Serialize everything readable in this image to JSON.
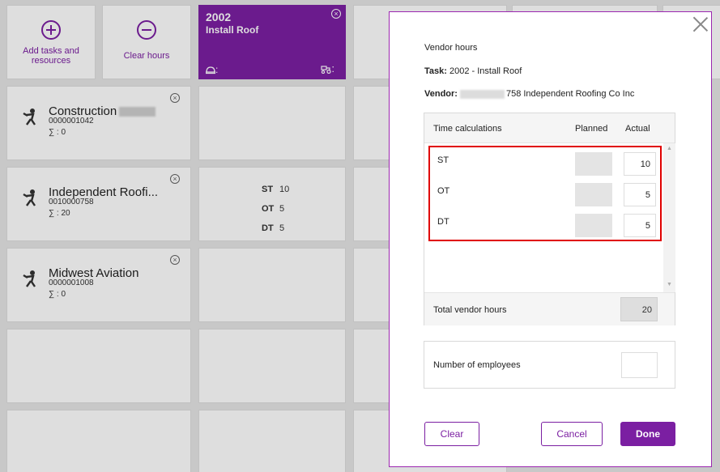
{
  "colors": {
    "accent": "#7b1fa2",
    "highlight": "#e00000"
  },
  "toolbar": {
    "add_label": "Add tasks and resources",
    "clear_label": "Clear hours"
  },
  "task_card": {
    "number": "2002",
    "name": "Install Roof",
    "labor_icon": "hard-hat-icon",
    "labor_value": ":",
    "equipment_icon": "tractor-icon",
    "equipment_value": ":"
  },
  "resources": [
    {
      "name": "Construction",
      "code": "0000001042",
      "sum": "∑ : 0"
    },
    {
      "name": "Independent Roofi...",
      "code": "0010000758",
      "sum": "∑ : 20"
    },
    {
      "name": "Midwest Aviation",
      "code": "0000001008",
      "sum": "∑ : 0"
    }
  ],
  "hours_cell": [
    {
      "label": "ST",
      "value": "10"
    },
    {
      "label": "OT",
      "value": "5"
    },
    {
      "label": "DT",
      "value": "5"
    }
  ],
  "modal": {
    "title": "Vendor hours",
    "task_label": "Task:",
    "task_value": "2002 - Install Roof",
    "vendor_label": "Vendor:",
    "vendor_value": "758 Independent Roofing Co Inc",
    "table": {
      "col_time": "Time calculations",
      "col_planned": "Planned",
      "col_actual": "Actual",
      "rows": [
        {
          "label": "ST",
          "planned": "",
          "actual": "10"
        },
        {
          "label": "OT",
          "planned": "",
          "actual": "5"
        },
        {
          "label": "DT",
          "planned": "",
          "actual": "5"
        }
      ],
      "total_label": "Total vendor hours",
      "total_value": "20"
    },
    "employees_label": "Number of employees",
    "employees_value": "",
    "buttons": {
      "clear": "Clear",
      "cancel": "Cancel",
      "done": "Done"
    }
  }
}
